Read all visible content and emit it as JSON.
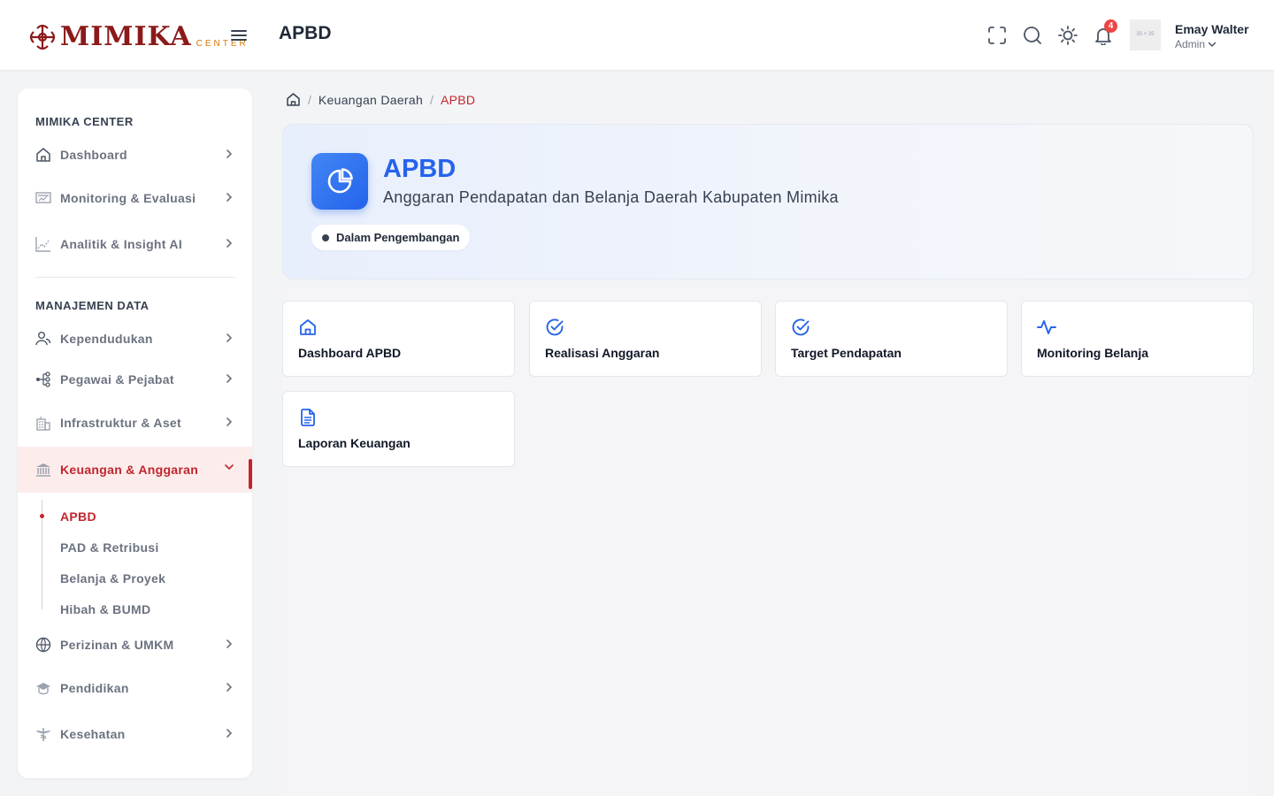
{
  "brand": {
    "name": "MIMIKA",
    "sub": "CENTER"
  },
  "header": {
    "title": "APBD",
    "notification_count": "4",
    "avatar_placeholder": "35 × 35",
    "user": {
      "name": "Emay Walter",
      "role": "Admin"
    }
  },
  "sidebar": {
    "section1": "MIMIKA CENTER",
    "section2": "MANAJEMEN DATA",
    "items": [
      {
        "label": "Dashboard",
        "icon": "home-icon"
      },
      {
        "label": "Monitoring & Evaluasi",
        "icon": "monitor-icon"
      },
      {
        "label": "Analitik & Insight AI",
        "icon": "analytics-icon"
      },
      {
        "label": "Kependudukan",
        "icon": "users-icon"
      },
      {
        "label": "Pegawai & Pejabat",
        "icon": "org-chart-icon"
      },
      {
        "label": "Infrastruktur & Aset",
        "icon": "building-icon"
      },
      {
        "label": "Keuangan & Anggaran",
        "icon": "bank-icon"
      },
      {
        "label": "Perizinan & UMKM",
        "icon": "globe-icon"
      },
      {
        "label": "Pendidikan",
        "icon": "graduation-cap-icon"
      },
      {
        "label": "Kesehatan",
        "icon": "caduceus-icon"
      }
    ],
    "sub_items": [
      "APBD",
      "PAD & Retribusi",
      "Belanja & Proyek",
      "Hibah & BUMD"
    ]
  },
  "breadcrumb": {
    "parent": "Keuangan Daerah",
    "current": "APBD"
  },
  "hero": {
    "title": "APBD",
    "subtitle": "Anggaran Pendapatan dan Belanja Daerah Kabupaten Mimika",
    "status": "Dalam Pengembangan"
  },
  "cards": [
    {
      "label": "Dashboard APBD",
      "icon": "home-icon"
    },
    {
      "label": "Realisasi Anggaran",
      "icon": "check-circle-icon"
    },
    {
      "label": "Target Pendapatan",
      "icon": "check-circle-icon"
    },
    {
      "label": "Monitoring Belanja",
      "icon": "activity-icon"
    },
    {
      "label": "Laporan Keuangan",
      "icon": "document-icon"
    }
  ],
  "colors": {
    "accent": "#c0262d",
    "primary": "#2563eb",
    "brand": "#8b1a1a"
  }
}
